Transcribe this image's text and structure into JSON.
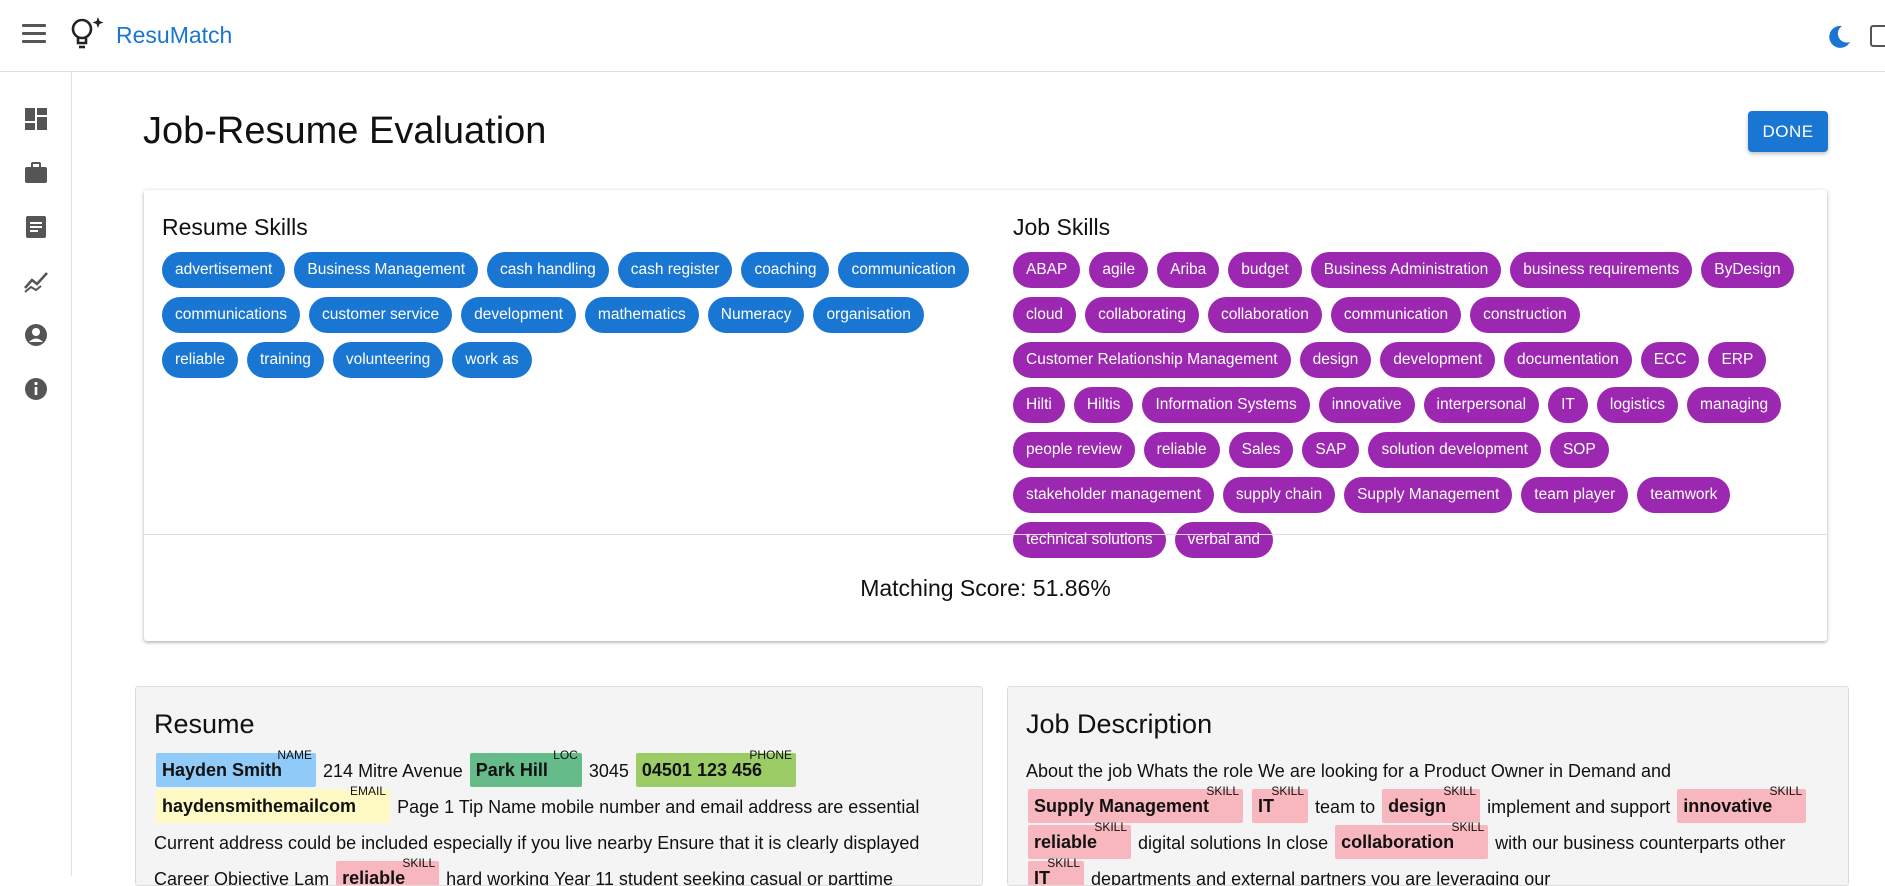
{
  "app": {
    "name": "ResuMatch"
  },
  "page": {
    "title": "Job-Resume Evaluation",
    "done_label": "DONE"
  },
  "resume_skills": {
    "title": "Resume Skills",
    "items": [
      "advertisement",
      "Business Management",
      "cash handling",
      "cash register",
      "coaching",
      "communication",
      "communications",
      "customer service",
      "development",
      "mathematics",
      "Numeracy",
      "organisation",
      "reliable",
      "training",
      "volunteering",
      "work as"
    ]
  },
  "job_skills": {
    "title": "Job Skills",
    "items": [
      "ABAP",
      "agile",
      "Ariba",
      "budget",
      "Business Administration",
      "business requirements",
      "ByDesign",
      "cloud",
      "collaborating",
      "collaboration",
      "communication",
      "construction",
      "Customer Relationship Management",
      "design",
      "development",
      "documentation",
      "ECC",
      "ERP",
      "Hilti",
      "Hiltis",
      "Information Systems",
      "innovative",
      "interpersonal",
      "IT",
      "logistics",
      "managing",
      "people review",
      "reliable",
      "Sales",
      "SAP",
      "solution development",
      "SOP",
      "stakeholder management",
      "supply chain",
      "Supply Management",
      "team player",
      "teamwork",
      "technical solutions",
      "verbal and"
    ]
  },
  "matching_score": "Matching Score: 51.86%",
  "resume": {
    "title": "Resume",
    "segments": [
      {
        "text": "Hayden Smith",
        "tag": "NAME"
      },
      {
        "text": " 214 Mitre Avenue "
      },
      {
        "text": "Park Hill",
        "tag": "LOC"
      },
      {
        "text": " 3045 "
      },
      {
        "text": "04501 123 456",
        "tag": "PHONE"
      },
      {
        "text": " "
      },
      {
        "text": "haydensmithemailcom",
        "tag": "EMAIL"
      },
      {
        "text": " Page 1 Tip Name mobile number and email address are essential Current address could be included especially if you live nearby Ensure that it is clearly displayed Career Objective Lam "
      },
      {
        "text": "reliable",
        "tag": "SKILL"
      },
      {
        "text": " hard working Year 11 student seeking casual or parttime"
      }
    ]
  },
  "job_description": {
    "title": "Job Description",
    "segments": [
      {
        "text": "About the job Whats the role We are looking for a Product Owner in Demand and "
      },
      {
        "text": "Supply Management",
        "tag": "SKILL"
      },
      {
        "text": " "
      },
      {
        "text": "IT",
        "tag": "SKILL"
      },
      {
        "text": " team to "
      },
      {
        "text": "design",
        "tag": "SKILL"
      },
      {
        "text": " implement and support "
      },
      {
        "text": "innovative",
        "tag": "SKILL"
      },
      {
        "text": " "
      },
      {
        "text": "reliable",
        "tag": "SKILL"
      },
      {
        "text": " digital solutions In close "
      },
      {
        "text": "collaboration",
        "tag": "SKILL"
      },
      {
        "text": " with our business counterparts other "
      },
      {
        "text": "IT",
        "tag": "SKILL"
      },
      {
        "text": " departments and external partners you are leveraging our"
      }
    ]
  },
  "colors": {
    "primary": "#1976d2",
    "job_chip": "#9c27b0",
    "name_tag": "#90caf9",
    "loc_tag": "#66bb8a",
    "phone_tag": "#9ccc65",
    "email_tag": "#fff9c4",
    "skill_tag": "#f8b7be"
  }
}
